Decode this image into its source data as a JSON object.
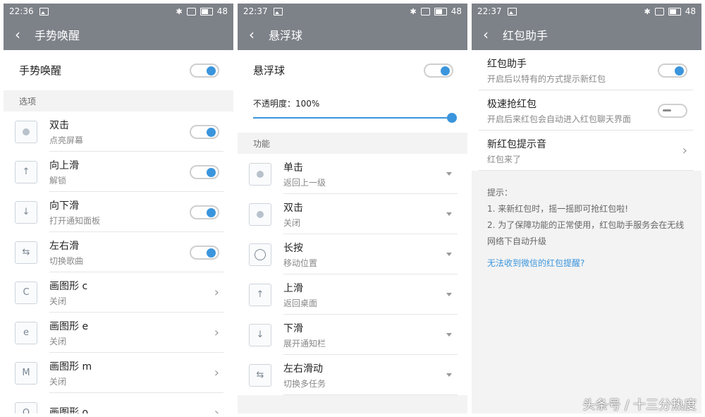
{
  "watermark": "头条号 / 十三分热度",
  "colors": {
    "accent": "#3b95dc",
    "header": "#7d8188"
  },
  "panel1": {
    "status": {
      "time": "22:36",
      "battery": "48"
    },
    "title": "手势唤醒",
    "master": {
      "label": "手势唤醒",
      "on": true
    },
    "section": "选项",
    "items": [
      {
        "title": "双击",
        "subtitle": "点亮屏幕",
        "icon": "double-tap-icon",
        "control": "toggle-on"
      },
      {
        "title": "向上滑",
        "subtitle": "解锁",
        "icon": "swipe-up-icon",
        "control": "toggle-on"
      },
      {
        "title": "向下滑",
        "subtitle": "打开通知面板",
        "icon": "swipe-down-icon",
        "control": "toggle-on"
      },
      {
        "title": "左右滑",
        "subtitle": "切换歌曲",
        "icon": "swipe-left-right-icon",
        "control": "toggle-on"
      },
      {
        "title": "画图形 c",
        "subtitle": "关闭",
        "icon": "draw-c-icon",
        "control": "chevron"
      },
      {
        "title": "画图形 e",
        "subtitle": "关闭",
        "icon": "draw-e-icon",
        "control": "chevron"
      },
      {
        "title": "画图形 m",
        "subtitle": "关闭",
        "icon": "draw-m-icon",
        "control": "chevron"
      },
      {
        "title": "画图形 o",
        "subtitle": "",
        "icon": "draw-o-icon",
        "control": "chevron"
      }
    ]
  },
  "panel2": {
    "status": {
      "time": "22:37",
      "battery": "48"
    },
    "title": "悬浮球",
    "master": {
      "label": "悬浮球",
      "on": true
    },
    "opacity_label": "不透明度：100%",
    "opacity_value": 100,
    "section": "功能",
    "items": [
      {
        "title": "单击",
        "subtitle": "返回上一级",
        "icon": "single-tap-icon"
      },
      {
        "title": "双击",
        "subtitle": "关闭",
        "icon": "double-tap-icon"
      },
      {
        "title": "长按",
        "subtitle": "移动位置",
        "icon": "long-press-icon"
      },
      {
        "title": "上滑",
        "subtitle": "返回桌面",
        "icon": "swipe-up-icon"
      },
      {
        "title": "下滑",
        "subtitle": "展开通知栏",
        "icon": "swipe-down-icon"
      },
      {
        "title": "左右滑动",
        "subtitle": "切换多任务",
        "icon": "swipe-left-right-icon"
      }
    ]
  },
  "panel3": {
    "status": {
      "time": "22:37",
      "battery": "48"
    },
    "title": "红包助手",
    "items": [
      {
        "title": "红包助手",
        "subtitle": "开启后以特有的方式提示新红包",
        "control": "toggle-on"
      },
      {
        "title": "极速抢红包",
        "subtitle": "开启后来红包会自动进入红包聊天界面",
        "control": "toggle-off"
      },
      {
        "title": "新红包提示音",
        "subtitle": "红包来了",
        "control": "chevron"
      }
    ],
    "tips": {
      "heading": "提示：",
      "line1": "1. 来新红包时，摇一摇即可抢红包啦!",
      "line2": "2. 为了保障功能的正常使用，红包助手服务会在无线网络下自动升级"
    },
    "link": "无法收到微信的红包提醒?"
  }
}
